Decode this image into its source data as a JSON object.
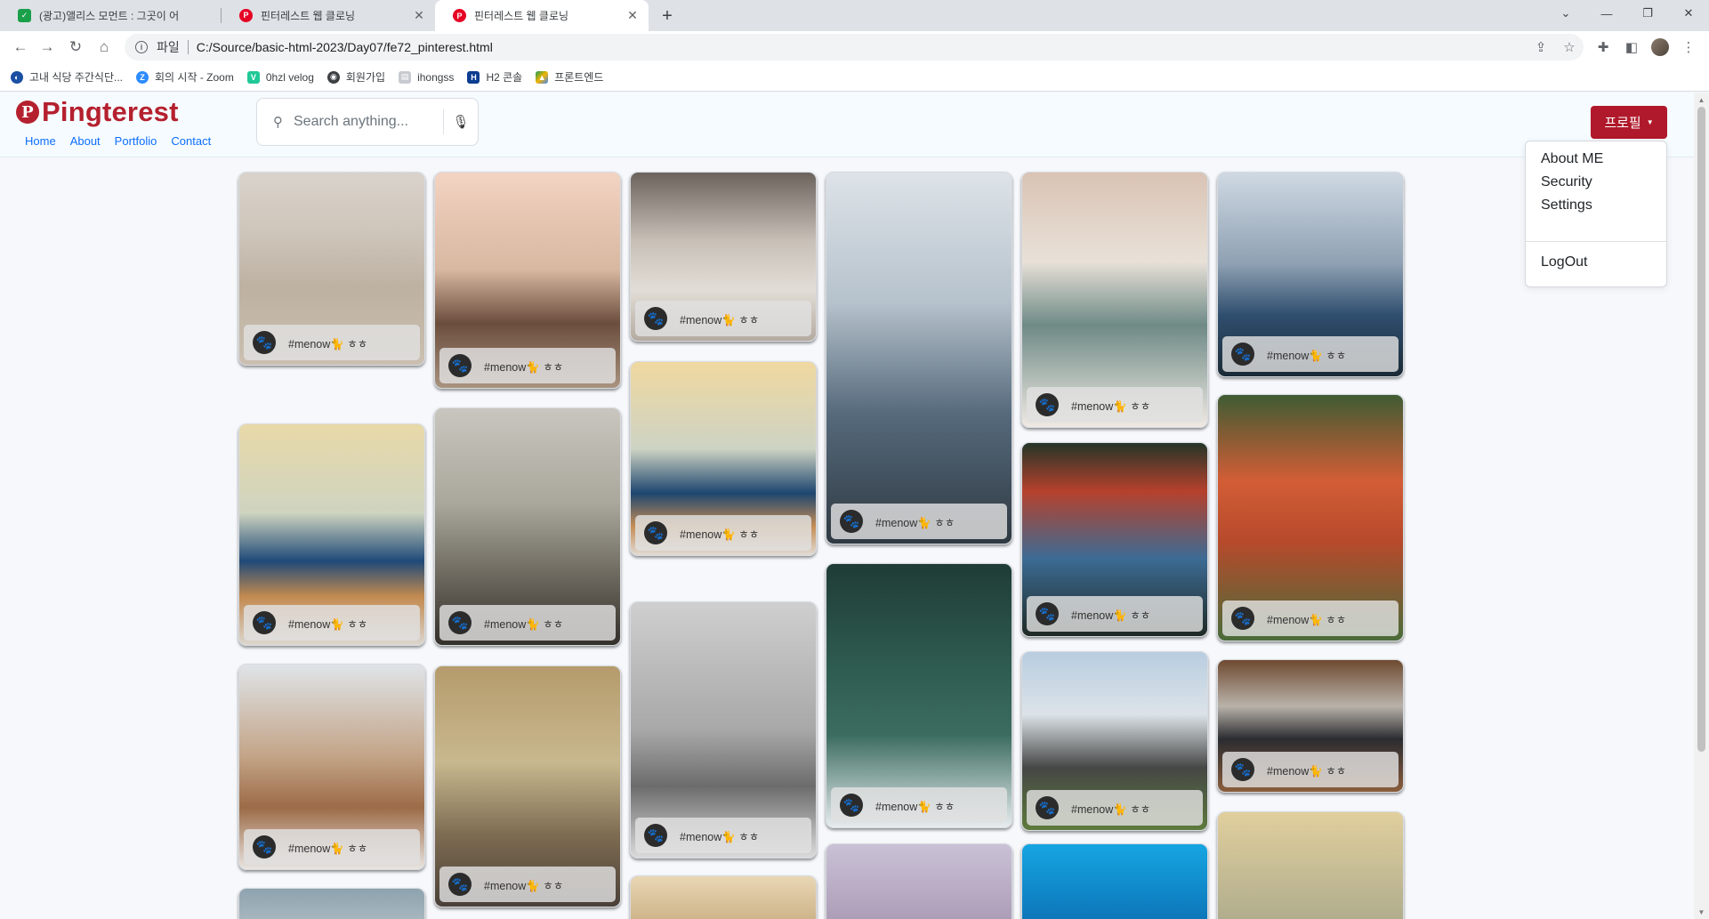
{
  "browser": {
    "tabs": [
      {
        "title": "(광고)앨리스 모먼트 : 그곳이 어",
        "favicon_color": "#1aa04a",
        "active": false
      },
      {
        "title": "핀터레스트 웹 클로닝",
        "favicon_color": "#e60023",
        "active": false
      },
      {
        "title": "핀터레스트 웹 클로닝",
        "favicon_color": "#e60023",
        "active": true
      }
    ],
    "address": {
      "scheme": "파일",
      "url": "C:/Source/basic-html-2023/Day07/fe72_pinterest.html"
    },
    "bookmarks": [
      {
        "label": "고내 식당 주간식단...",
        "icon_color": "#1a4fa3"
      },
      {
        "label": "회의 시작 - Zoom",
        "icon_color": "#2d8cff"
      },
      {
        "label": "0hzl velog",
        "icon_color": "#20c997"
      },
      {
        "label": "회원가입",
        "icon_color": "#3c4043"
      },
      {
        "label": "ihongss",
        "icon_color": "#9aa0a6"
      },
      {
        "label": "H2 콘솔",
        "icon_color": "#0b3d91"
      },
      {
        "label": "프론트엔드",
        "icon_color": "#f4b400"
      }
    ]
  },
  "site": {
    "logo": "Pingterest",
    "nav": [
      "Home",
      "About",
      "Portfolio",
      "Contact"
    ],
    "search_placeholder": "Search anything...",
    "profile_button": "프로필",
    "dropdown": [
      "About ME",
      "Security",
      "Settings",
      "LogOut"
    ],
    "accent_color": "#b0192b"
  },
  "pin_tag": "#menow🐈 ㅎㅎ",
  "pins": [
    {
      "name": "desert-dunes",
      "gradient": "linear-gradient(180deg,#d9d3cc 0%,#cfc6bb 30%,#bdb1a2 60%,#cbbfb0 100%)"
    },
    {
      "name": "sea-horizon",
      "gradient": "linear-gradient(180deg,#e8d9a8 0%,#cfd4c0 40%,#1f4a78 62%,#c28a50 78%,#dcd6cf 100%)"
    },
    {
      "name": "walrus",
      "gradient": "linear-gradient(180deg,#dfe4e8 0%,#c3a487 45%,#9c6b47 70%,#e8e4e0 100%)"
    },
    {
      "name": "phone-sunset",
      "gradient": "linear-gradient(180deg,#f3d3c2 0%,#d8b8a0 45%,#6b4d3e 70%,#a89380 100%)"
    },
    {
      "name": "dome-building",
      "gradient": "linear-gradient(180deg,#c8c6be 0%,#aaa79c 40%,#6e6a60 70%,#34302a 100%)"
    },
    {
      "name": "grand-central",
      "gradient": "linear-gradient(180deg,#b59b6c 0%,#c8b88e 40%,#7e6c52 70%,#4a4038 100%)"
    },
    {
      "name": "tricycle",
      "gradient": "linear-gradient(180deg,#6b625c 0%,#c6bfb6 40%,#e2ddd6 70%,#b4aaa0 100%)"
    },
    {
      "name": "sea-horizon-2",
      "gradient": "linear-gradient(180deg,#f0d8a0 0%,#cdd3c3 45%,#1d466f 68%,#c58d55 85%,#e1dbd3 100%)"
    },
    {
      "name": "pier-bw",
      "gradient": "linear-gradient(180deg,#cfcfcf 0%,#a8a8a8 50%,#6c6c6c 72%,#dadada 100%)"
    },
    {
      "name": "snowy-rooftops",
      "gradient": "linear-gradient(180deg,#dde3e8 0%,#b6c2cc 35%,#566a7c 65%,#2f3942 100%)"
    },
    {
      "name": "bridge-under",
      "gradient": "linear-gradient(180deg,#1f3c36 0%,#2f5c51 40%,#3c6c60 65%,#e6ecef 100%)"
    },
    {
      "name": "polaroid-hand",
      "gradient": "linear-gradient(180deg,#d9c3b4 0%,#e8e1d8 35%,#6f8a86 60%,#efe9e2 100%)"
    },
    {
      "name": "camera-girl",
      "gradient": "linear-gradient(180deg,#243528 0%,#b6412c 25%,#3c6b94 60%,#1f2a24 100%)"
    },
    {
      "name": "rocks-field",
      "gradient": "linear-gradient(180deg,#b8cde0 0%,#dce3e8 35%,#454745 65%,#5e7a3c 100%)"
    },
    {
      "name": "mountain-lake",
      "gradient": "linear-gradient(180deg,#cfd9e3 0%,#8ea0b2 45%,#2f4e6e 70%,#1b2b36 100%)"
    },
    {
      "name": "tulips",
      "gradient": "linear-gradient(180deg,#3f5c33 0%,#d25d36 35%,#b64a2b 60%,#4a6c3a 100%)"
    },
    {
      "name": "laptop-desk",
      "gradient": "linear-gradient(180deg,#6e4a30 0%,#b9b2aa 35%,#2b2c30 60%,#8a5d3c 100%)"
    },
    {
      "name": "sky-partial",
      "gradient": "linear-gradient(180deg,#8da3af 0%,#b8c4c8 100%)"
    },
    {
      "name": "tree-partial",
      "gradient": "linear-gradient(180deg,#e9d7b4 0%,#c8ad82 100%)"
    },
    {
      "name": "jump-partial",
      "gradient": "linear-gradient(180deg,#cac1d6 0%,#a898b3 100%)"
    },
    {
      "name": "ocean-partial",
      "gradient": "linear-gradient(180deg,#16a5e2 0%,#0b6fb3 100%)"
    },
    {
      "name": "clouds-partial",
      "gradient": "linear-gradient(180deg,#e1cf9d 0%,#a9a88b 100%)"
    }
  ]
}
